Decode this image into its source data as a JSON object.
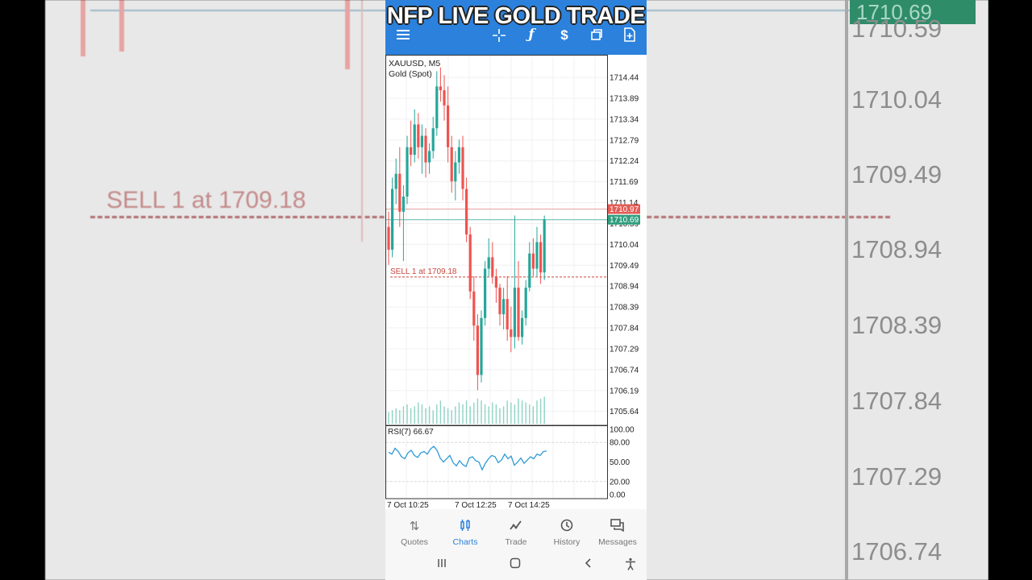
{
  "overlay": {
    "title": "NFP LIVE GOLD TRADE"
  },
  "background": {
    "price_ticks": [
      "1710.59",
      "1710.04",
      "1709.49",
      "1708.94",
      "1708.39",
      "1707.84",
      "1707.29",
      "1706.74"
    ],
    "current_price_tag": "1710.69",
    "sell_label": "SELL 1 at 1709.18"
  },
  "toolbar": {
    "menu_icon": "menu-icon",
    "crosshair_icon": "crosshair-icon",
    "indicator_icon": "function-icon",
    "new_order_icon": "dollar-icon",
    "objects_icon": "windows-icon",
    "templates_icon": "document-add-icon"
  },
  "chart": {
    "symbol": "XAUUSD, M5",
    "description": "Gold (Spot)",
    "sell_line_label": "SELL 1 at 1709.18",
    "bid_tag": "1710.97",
    "ask_tag": "1710.69",
    "price_axis": [
      "1714.44",
      "1713.89",
      "1713.34",
      "1712.79",
      "1712.24",
      "1711.69",
      "1711.14",
      "1710.59",
      "1710.04",
      "1709.49",
      "1708.94",
      "1708.39",
      "1707.84",
      "1707.29",
      "1706.74",
      "1706.19",
      "1705.64"
    ],
    "rsi_label": "RSI(7) 66.67",
    "rsi_axis": [
      "100.00",
      "80.00",
      "50.00",
      "20.00",
      "0.00"
    ],
    "time_axis": [
      "7 Oct 10:25",
      "7 Oct 12:25",
      "7 Oct 14:25"
    ],
    "colors": {
      "bull": "#26a69a",
      "bear": "#ef5350",
      "rsi": "#2e9bd6",
      "volume": "#8fd3c3",
      "accent": "#2b81dc"
    }
  },
  "chart_data": {
    "type": "candlestick",
    "candles": [
      [
        1710.5,
        1710.9,
        1709.5,
        1709.9
      ],
      [
        1709.9,
        1711.8,
        1709.7,
        1711.5
      ],
      [
        1711.5,
        1712.3,
        1711.1,
        1711.9
      ],
      [
        1711.9,
        1712.6,
        1710.5,
        1710.9
      ],
      [
        1710.9,
        1711.6,
        1709.6,
        1711.3
      ],
      [
        1711.3,
        1712.9,
        1711.1,
        1712.6
      ],
      [
        1712.6,
        1713.3,
        1712.1,
        1712.4
      ],
      [
        1712.4,
        1713.6,
        1712.2,
        1713.2
      ],
      [
        1713.2,
        1713.5,
        1712.3,
        1712.6
      ],
      [
        1712.6,
        1713.2,
        1711.9,
        1712.9
      ],
      [
        1712.9,
        1713.1,
        1711.8,
        1712.2
      ],
      [
        1712.2,
        1712.7,
        1711.9,
        1712.5
      ],
      [
        1712.5,
        1713.4,
        1712.3,
        1713.1
      ],
      [
        1713.1,
        1714.6,
        1712.9,
        1714.2
      ],
      [
        1714.2,
        1714.7,
        1713.8,
        1714.1
      ],
      [
        1714.1,
        1714.5,
        1713.3,
        1713.7
      ],
      [
        1713.7,
        1714.2,
        1712.2,
        1712.6
      ],
      [
        1712.6,
        1712.9,
        1711.4,
        1711.7
      ],
      [
        1711.7,
        1712.5,
        1711.2,
        1712.2
      ],
      [
        1712.2,
        1712.8,
        1711.9,
        1712.6
      ],
      [
        1712.6,
        1712.9,
        1711.2,
        1711.5
      ],
      [
        1711.5,
        1711.8,
        1710.1,
        1710.3
      ],
      [
        1710.3,
        1710.5,
        1708.6,
        1708.8
      ],
      [
        1708.8,
        1709.2,
        1707.5,
        1707.9
      ],
      [
        1707.9,
        1708.2,
        1706.2,
        1706.6
      ],
      [
        1706.6,
        1708.3,
        1706.4,
        1708.1
      ],
      [
        1708.1,
        1709.6,
        1707.9,
        1709.4
      ],
      [
        1709.4,
        1710.2,
        1709.2,
        1709.7
      ],
      [
        1709.7,
        1710.1,
        1709.0,
        1709.2
      ],
      [
        1709.2,
        1709.4,
        1708.5,
        1708.9
      ],
      [
        1708.9,
        1709.0,
        1707.9,
        1708.2
      ],
      [
        1708.2,
        1708.9,
        1707.8,
        1708.6
      ],
      [
        1708.6,
        1709.2,
        1707.5,
        1707.8
      ],
      [
        1707.8,
        1708.4,
        1707.2,
        1707.6
      ],
      [
        1707.6,
        1710.8,
        1707.3,
        1708.9
      ],
      [
        1708.9,
        1709.6,
        1707.5,
        1707.6
      ],
      [
        1707.6,
        1708.3,
        1707.4,
        1708.1
      ],
      [
        1708.1,
        1709.1,
        1707.9,
        1708.9
      ],
      [
        1708.9,
        1710.1,
        1708.8,
        1709.8
      ],
      [
        1709.8,
        1710.2,
        1709.2,
        1709.4
      ],
      [
        1709.4,
        1710.5,
        1709.2,
        1710.1
      ],
      [
        1710.1,
        1710.3,
        1709.0,
        1709.3
      ],
      [
        1709.3,
        1710.8,
        1709.1,
        1710.7
      ]
    ],
    "price_range": [
      1705.4,
      1714.95
    ],
    "rsi_values": [
      65,
      62,
      71,
      66,
      58,
      55,
      64,
      68,
      60,
      57,
      64,
      66,
      62,
      70,
      74,
      68,
      56,
      50,
      55,
      60,
      49,
      44,
      52,
      46,
      43,
      56,
      58,
      52,
      50,
      38,
      48,
      55,
      60,
      58,
      49,
      53,
      62,
      55,
      59,
      45,
      50,
      56,
      48,
      53,
      58,
      55,
      62,
      60,
      66,
      67
    ],
    "rsi_range": [
      0,
      100
    ],
    "volumes": [
      6,
      7,
      8,
      7,
      9,
      10,
      8,
      9,
      11,
      10,
      8,
      9,
      7,
      10,
      12,
      9,
      8,
      7,
      9,
      11,
      10,
      12,
      9,
      11,
      13,
      12,
      10,
      9,
      11,
      10,
      8,
      9,
      12,
      11,
      10,
      13,
      12,
      11,
      10,
      9,
      12,
      13,
      14
    ],
    "sell_level": 1709.18,
    "bid": 1710.97,
    "ask": 1710.69
  },
  "bottom_nav": [
    {
      "label": "Quotes",
      "icon": "arrows-updown-icon"
    },
    {
      "label": "Charts",
      "icon": "candles-icon"
    },
    {
      "label": "Trade",
      "icon": "trend-icon"
    },
    {
      "label": "History",
      "icon": "history-icon"
    },
    {
      "label": "Messages",
      "icon": "messages-icon"
    }
  ],
  "system_nav": {
    "recents": "recents-icon",
    "home": "home-icon",
    "back": "back-icon",
    "accessibility": "accessibility-icon"
  }
}
